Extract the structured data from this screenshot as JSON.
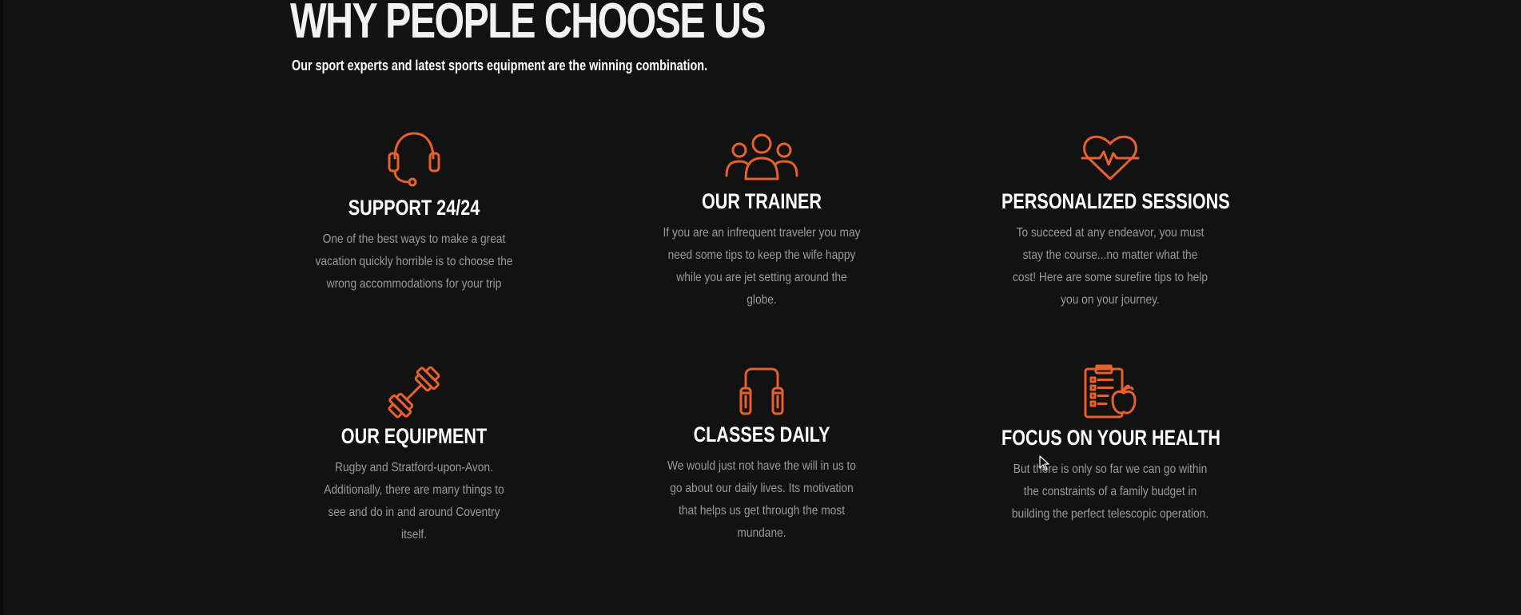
{
  "section": {
    "title": "WHY PEOPLE CHOOSE US",
    "subtitle": "Our sport experts and latest sports equipment are the winning combination."
  },
  "colors": {
    "background": "#121212",
    "accent": "#e8602c",
    "heading": "#ffffff",
    "body_text": "#9a9a9a"
  },
  "features": [
    {
      "icon": "headset-icon",
      "title": "SUPPORT 24/24",
      "text": "One of the best ways to make a great vacation quickly horrible is to choose the wrong accommodations for your trip"
    },
    {
      "icon": "team-icon",
      "title": "OUR TRAINER",
      "text": "If you are an infrequent traveler you may need some tips to keep the wife happy while you are jet setting around the globe."
    },
    {
      "icon": "heart-pulse-icon",
      "title": "PERSONALIZED SESSIONS",
      "text": "To succeed at any endeavor, you must stay the course...no matter what the cost! Here are some surefire tips to help you on your journey."
    },
    {
      "icon": "dumbbell-icon",
      "title": "OUR EQUIPMENT",
      "text": "Rugby and Stratford-upon-Avon. Additionally, there are many things to see and do in and around Coventry itself."
    },
    {
      "icon": "jump-rope-icon",
      "title": "CLASSES DAILY",
      "text": "We would just not have the will in us to go about our daily lives. Its motivation that helps us get through the most mundane."
    },
    {
      "icon": "clipboard-apple-icon",
      "title": "FOCUS ON YOUR HEALTH",
      "text": "But there is only so far we can go within the constraints of a family budget in building the perfect telescopic operation."
    }
  ]
}
